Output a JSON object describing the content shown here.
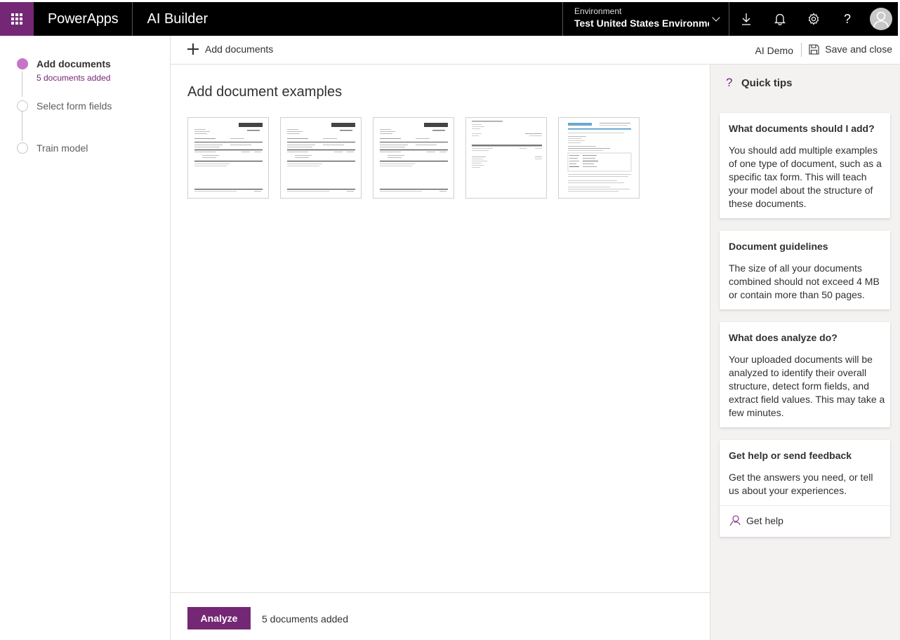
{
  "topbar": {
    "brand": "PowerApps",
    "app": "AI Builder",
    "environment_label": "Environment",
    "environment_value": "Test United States Environme…"
  },
  "steps": [
    {
      "title": "Add documents",
      "subtitle": "5 documents added",
      "state": "active"
    },
    {
      "title": "Select form fields",
      "state": "idle"
    },
    {
      "title": "Train model",
      "state": "idle"
    }
  ],
  "commandbar": {
    "add_label": "Add documents",
    "model_name": "AI Demo",
    "save_label": "Save and close"
  },
  "main": {
    "title": "Add document examples",
    "thumbnails": [
      "document-1",
      "document-2",
      "document-3",
      "document-4",
      "document-5"
    ]
  },
  "footer": {
    "analyze_label": "Analyze",
    "count_text": "5 documents added"
  },
  "tips": {
    "title": "Quick tips",
    "cards": [
      {
        "title": "What documents should I add?",
        "body": "You should add multiple examples of one type of document, such as a specific tax form. This will teach your model about the structure of these documents."
      },
      {
        "title": "Document guidelines",
        "body": "The size of all your documents combined should not exceed 4 MB or contain more than 50 pages."
      },
      {
        "title": "What does analyze do?",
        "body": "Your uploaded documents will be analyzed to identify their overall structure, detect form fields, and extract field values. This may take a few minutes."
      },
      {
        "title": "Get help or send feedback",
        "body": "Get the answers you need, or tell us about your experiences.",
        "link": "Get help"
      }
    ]
  },
  "colors": {
    "accent": "#742774",
    "step_active": "#c773c7",
    "topbar": "#000000"
  }
}
